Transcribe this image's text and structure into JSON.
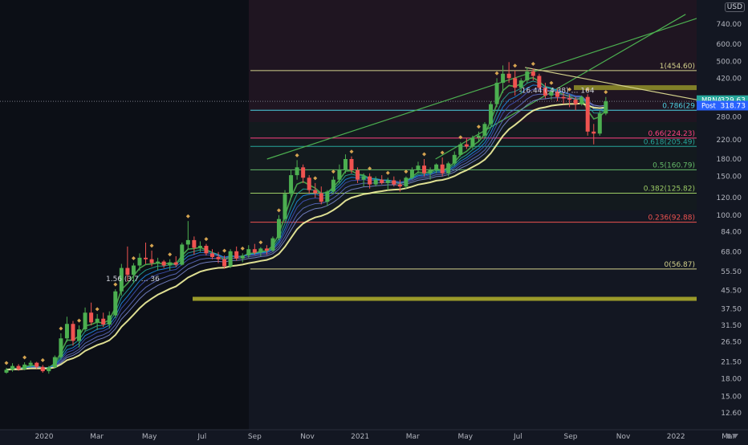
{
  "header": {
    "currency": "USD"
  },
  "price_tags": {
    "symbol": {
      "label": "MRNA",
      "value": "329.63",
      "color": "#26a69a"
    },
    "post": {
      "label": "Post",
      "value": "318.73",
      "color": "#2962ff"
    }
  },
  "colors": {
    "background": "#131722",
    "up": "#4caf50",
    "down": "#ef5350",
    "text": "#b2b5be",
    "trendline": "#4caf50",
    "yellow_line": "#d4d28c",
    "olive_band": "#9a9a2a"
  },
  "chart_data": {
    "type": "candlestick",
    "scale": "log",
    "y_ticks": [
      12.6,
      15.0,
      18.0,
      21.5,
      26.5,
      31.5,
      37.5,
      45.5,
      55.5,
      68.0,
      84.0,
      100.0,
      120.0,
      150.0,
      180.0,
      220.0,
      280.0,
      340.0,
      420.0,
      500.0,
      600.0,
      740.0
    ],
    "y_tick_labels": [
      "12.60",
      "15.00",
      "18.00",
      "21.50",
      "26.50",
      "31.50",
      "37.50",
      "45.50",
      "55.50",
      "68.00",
      "84.00",
      "100.00",
      "120.00",
      "150.00",
      "180.00",
      "220.00",
      "280.00",
      "340.00",
      "420.00",
      "500.00",
      "600.00",
      "740.00"
    ],
    "x_ticks": [
      "2020",
      "Mar",
      "May",
      "Jul",
      "Sep",
      "Nov",
      "2021",
      "Mar",
      "May",
      "Jul",
      "Sep",
      "Nov",
      "2022",
      "Mar"
    ],
    "x_tick_months": [
      0,
      2,
      4,
      6,
      8,
      10,
      12,
      14,
      16,
      18,
      20,
      22,
      24,
      26
    ],
    "fib_levels": [
      {
        "label": "1(454.60)",
        "value": 454.6,
        "color": "#d4d28c"
      },
      {
        "label": "0.786(29",
        "value": 300,
        "color": "#4dd0e1"
      },
      {
        "label": "0.66(224.23)",
        "value": 224.23,
        "color": "#ff4081"
      },
      {
        "label": "0.618(205.49)",
        "value": 205.49,
        "color": "#26a69a"
      },
      {
        "label": "0.5(160.79)",
        "value": 160.79,
        "color": "#66bb6a"
      },
      {
        "label": "0.382(125.82)",
        "value": 125.82,
        "color": "#9ccc65"
      },
      {
        "label": "0.236(92.88)",
        "value": 92.88,
        "color": "#ef5350"
      },
      {
        "label": "0(56.87)",
        "value": 56.87,
        "color": "#d4d28c"
      }
    ],
    "annotations": [
      {
        "text": "1.56 (3.7 … 36",
        "month": 4.8,
        "price": 50
      },
      {
        "text": "-16.44 (-4.38) … 164",
        "month": 20.9,
        "price": 360
      }
    ],
    "weekly_candles": [
      [
        0,
        19.2,
        20.2,
        19.0,
        19.8
      ],
      [
        0.23,
        19.8,
        21.2,
        19.4,
        20.6
      ],
      [
        0.46,
        20.6,
        21.0,
        19.6,
        19.9
      ],
      [
        0.69,
        19.9,
        21.4,
        19.7,
        20.9
      ],
      [
        0.92,
        20.9,
        21.8,
        20.2,
        21.3
      ],
      [
        1.15,
        21.3,
        21.5,
        20.0,
        20.4
      ],
      [
        1.38,
        20.4,
        20.8,
        19.2,
        19.5
      ],
      [
        1.61,
        19.5,
        20.6,
        19.0,
        20.3
      ],
      [
        1.84,
        20.3,
        23.0,
        20.1,
        22.6
      ],
      [
        2.07,
        22.6,
        29.0,
        22.0,
        27.5
      ],
      [
        2.3,
        27.5,
        34.5,
        26.5,
        32.0
      ],
      [
        2.53,
        32.0,
        33.0,
        25.5,
        26.8
      ],
      [
        2.76,
        26.8,
        31.5,
        25.0,
        30.2
      ],
      [
        2.99,
        30.2,
        38.0,
        29.5,
        36.0
      ],
      [
        3.22,
        36.0,
        40.0,
        31.5,
        32.5
      ],
      [
        3.45,
        32.5,
        35.5,
        30.0,
        33.8
      ],
      [
        3.68,
        33.8,
        36.0,
        31.0,
        31.8
      ],
      [
        3.91,
        31.8,
        36.5,
        30.5,
        35.0
      ],
      [
        4.14,
        35.0,
        46.0,
        34.0,
        45.0
      ],
      [
        4.37,
        45.0,
        60.0,
        43.0,
        57.5
      ],
      [
        4.6,
        57.5,
        72.0,
        50.0,
        53.5
      ],
      [
        4.83,
        53.5,
        60.5,
        49.0,
        59.0
      ],
      [
        5.06,
        59.0,
        67.0,
        56.0,
        64.0
      ],
      [
        5.29,
        64.0,
        75.0,
        60.0,
        63.0
      ],
      [
        5.52,
        63.0,
        69.0,
        58.5,
        60.5
      ],
      [
        5.75,
        60.5,
        64.0,
        56.0,
        61.5
      ],
      [
        5.98,
        61.5,
        62.5,
        57.5,
        59.0
      ],
      [
        6.21,
        59.0,
        63.0,
        56.0,
        61.0
      ],
      [
        6.44,
        61.0,
        65.0,
        58.0,
        59.5
      ],
      [
        6.67,
        59.5,
        75.0,
        59.0,
        73.5
      ],
      [
        6.9,
        73.5,
        94.0,
        70.0,
        77.0
      ],
      [
        7.13,
        77.0,
        80.0,
        66.0,
        71.0
      ],
      [
        7.36,
        71.0,
        76.0,
        68.0,
        72.5
      ],
      [
        7.59,
        72.5,
        74.0,
        65.5,
        67.0
      ],
      [
        7.82,
        67.0,
        70.0,
        63.0,
        64.5
      ],
      [
        8.05,
        64.5,
        68.0,
        60.5,
        63.0
      ],
      [
        8.28,
        63.0,
        65.5,
        57.0,
        58.5
      ],
      [
        8.51,
        58.5,
        70.0,
        57.5,
        68.5
      ],
      [
        8.74,
        68.5,
        72.0,
        62.0,
        63.5
      ],
      [
        8.97,
        63.5,
        67.0,
        61.0,
        65.5
      ],
      [
        9.2,
        65.5,
        73.0,
        64.0,
        70.0
      ],
      [
        9.43,
        70.0,
        74.0,
        66.0,
        67.5
      ],
      [
        9.66,
        67.5,
        71.5,
        65.0,
        70.5
      ],
      [
        9.89,
        70.5,
        73.0,
        66.0,
        69.0
      ],
      [
        10.12,
        69.0,
        80.0,
        68.0,
        78.5
      ],
      [
        10.35,
        78.5,
        100.0,
        77.0,
        96.0
      ],
      [
        10.58,
        96.0,
        130.0,
        94.0,
        125.0
      ],
      [
        10.81,
        125.0,
        160.0,
        120.0,
        152.0
      ],
      [
        11.04,
        152.0,
        178.0,
        145.0,
        165.0
      ],
      [
        11.27,
        165.0,
        170.0,
        140.0,
        148.0
      ],
      [
        11.5,
        148.0,
        152.0,
        125.0,
        130.0
      ],
      [
        11.73,
        130.0,
        140.0,
        120.0,
        126.0
      ],
      [
        11.96,
        126.0,
        135.0,
        112.0,
        115.0
      ],
      [
        12.19,
        115.0,
        130.0,
        110.0,
        128.0
      ],
      [
        12.42,
        128.0,
        150.0,
        125.0,
        145.0
      ],
      [
        12.65,
        145.0,
        170.0,
        140.0,
        160.0
      ],
      [
        12.88,
        160.0,
        189.0,
        155.0,
        180.0
      ],
      [
        13.11,
        180.0,
        185.0,
        155.0,
        160.0
      ],
      [
        13.34,
        160.0,
        165.0,
        140.0,
        145.0
      ],
      [
        13.57,
        145.0,
        155.0,
        135.0,
        150.0
      ],
      [
        13.8,
        150.0,
        155.0,
        132.0,
        138.0
      ],
      [
        14.03,
        138.0,
        150.0,
        135.0,
        145.0
      ],
      [
        14.26,
        145.0,
        152.0,
        138.0,
        140.0
      ],
      [
        14.49,
        140.0,
        148.0,
        130.0,
        144.0
      ],
      [
        14.72,
        144.0,
        150.0,
        135.0,
        138.0
      ],
      [
        14.95,
        138.0,
        145.0,
        128.0,
        135.0
      ],
      [
        15.18,
        135.0,
        150.0,
        132.0,
        148.0
      ],
      [
        15.41,
        148.0,
        165.0,
        145.0,
        160.0
      ],
      [
        15.64,
        160.0,
        175.0,
        155.0,
        168.0
      ],
      [
        15.87,
        168.0,
        180.0,
        150.0,
        155.0
      ],
      [
        16.1,
        155.0,
        165.0,
        145.0,
        160.0
      ],
      [
        16.33,
        160.0,
        172.0,
        155.0,
        170.0
      ],
      [
        16.56,
        170.0,
        183.0,
        150.0,
        155.0
      ],
      [
        16.79,
        155.0,
        175.0,
        150.0,
        172.0
      ],
      [
        17.02,
        172.0,
        195.0,
        168.0,
        188.0
      ],
      [
        17.25,
        188.0,
        215.0,
        185.0,
        210.0
      ],
      [
        17.48,
        210.0,
        225.0,
        200.0,
        205.0
      ],
      [
        17.71,
        205.0,
        230.0,
        200.0,
        225.0
      ],
      [
        17.94,
        225.0,
        240.0,
        215.0,
        230.0
      ],
      [
        18.17,
        230.0,
        265.0,
        225.0,
        260.0
      ],
      [
        18.4,
        260.0,
        330.0,
        255.0,
        320.0
      ],
      [
        18.63,
        320.0,
        420.0,
        310.0,
        400.0
      ],
      [
        18.86,
        400.0,
        480.0,
        360.0,
        440.0
      ],
      [
        19.09,
        440.0,
        497.0,
        400.0,
        420.0
      ],
      [
        19.32,
        420.0,
        455.0,
        350.0,
        380.0
      ],
      [
        19.55,
        380.0,
        420.0,
        355.0,
        410.0
      ],
      [
        19.78,
        410.0,
        470.0,
        400.0,
        450.0
      ],
      [
        20.01,
        450.0,
        464.0,
        410.0,
        430.0
      ],
      [
        20.24,
        430.0,
        440.0,
        370.0,
        380.0
      ],
      [
        20.47,
        380.0,
        400.0,
        340.0,
        350.0
      ],
      [
        20.7,
        350.0,
        380.0,
        335.0,
        365.0
      ],
      [
        20.93,
        365.0,
        375.0,
        330.0,
        345.0
      ],
      [
        21.16,
        345.0,
        360.0,
        320.0,
        340.0
      ],
      [
        21.39,
        340.0,
        355.0,
        310.0,
        335.0
      ],
      [
        21.62,
        335.0,
        345.0,
        300.0,
        320.0
      ],
      [
        21.85,
        320.0,
        350.0,
        315.0,
        345.0
      ],
      [
        22.08,
        345.0,
        355.0,
        230.0,
        240.0
      ],
      [
        22.31,
        240.0,
        260.0,
        210.0,
        235.0
      ],
      [
        22.54,
        235.0,
        300.0,
        230.0,
        290.0
      ],
      [
        22.77,
        290.0,
        345.0,
        285.0,
        329.6
      ]
    ]
  }
}
